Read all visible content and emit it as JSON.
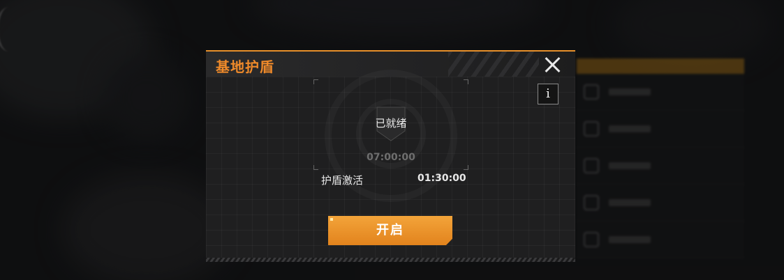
{
  "dialog": {
    "title": "基地护盾",
    "close_icon": "close-icon",
    "info_icon": "i",
    "status": {
      "label": "已就绪",
      "cooldown": "07:00:00"
    },
    "shield_activation": {
      "label": "护盾激活",
      "duration": "01:30:00"
    },
    "activate_button": "开启"
  },
  "colors": {
    "accent": "#ef8a2a",
    "button": "#e8902a"
  }
}
